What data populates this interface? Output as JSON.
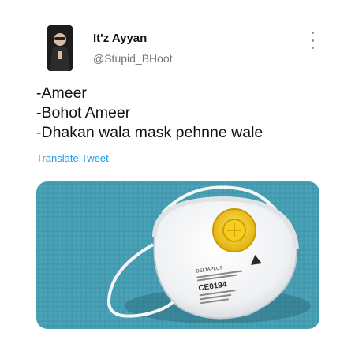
{
  "tweet": {
    "author_name": "It'z Ayyan",
    "author_handle": "@Stupid_BHoot",
    "lines": [
      "-Ameer",
      "-Bohot Ameer",
      "-Dhakan wala mask pehnne wale"
    ],
    "translate_label": "Translate Tweet"
  },
  "media": {
    "mask_brand": "DELTAPLUS",
    "mask_mark": "CE0194"
  },
  "icons": {
    "more": "more-vertical-icon",
    "avatar": "avatar"
  },
  "colors": {
    "link": "#1d9bf0",
    "handle": "#6e767d",
    "background_surface": "#4aa3b8",
    "valve": "#f2c200"
  }
}
